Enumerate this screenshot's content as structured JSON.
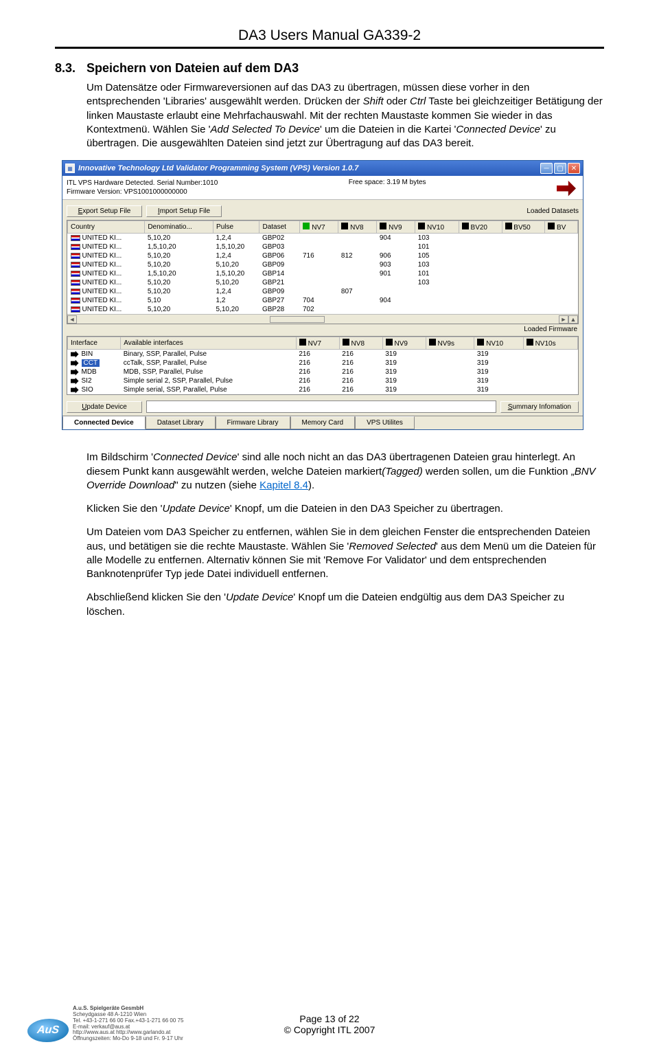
{
  "doc": {
    "header": "DA3 Users Manual GA339-2",
    "section_number": "8.3.",
    "section_title": "Speichern von Dateien auf dem DA3",
    "p1a": "Um Datensätze oder Firmwareversionen auf das DA3 zu übertragen, müssen diese vorher in den entsprechenden 'Libraries' ausgewählt werden. Drücken der ",
    "p1_shift": "Shift",
    "p1b": " oder ",
    "p1_ctrl": "Ctrl",
    "p1c": " Taste bei gleichzeitiger Betätigung der linken Maustaste erlaubt eine Mehrfachauswahl. Mit der rechten Maustaste kommen Sie wieder in das Kontextmenü. Wählen Sie '",
    "p1_add": "Add Selected To Device",
    "p1d": "' um die Dateien in die Kartei '",
    "p1_conn": "Connected Device",
    "p1e": "' zu übertragen. Die ausgewählten Dateien sind jetzt zur Übertragung auf das DA3 bereit.",
    "p2a": "Im Bildschirm '",
    "p2_conn": "Connected Device",
    "p2b": "' sind alle noch nicht an das DA3 übertragenen Dateien grau hinterlegt. An diesem Punkt kann ausgewählt werden, welche Dateien markiert",
    "p2_tagged": "(Tagged)",
    "p2c": " werden sollen, um die Funktion „",
    "p2_bnv": "BNV Override Download",
    "p2d": "\" zu nutzen (siehe ",
    "p2_link": "Kapitel 8.4",
    "p2e": ").",
    "p3a": "Klicken Sie den '",
    "p3_upd": "Update Device",
    "p3b": "'  Knopf, um die Dateien in den DA3 Speicher zu übertragen.",
    "p4a": "Um Dateien vom DA3 Speicher zu entfernen, wählen Sie in dem gleichen Fenster die entsprechenden Dateien aus, und betätigen sie die rechte Maustaste. Wählen Sie '",
    "p4_rem": "Removed Selected",
    "p4b": "' aus dem Menü um die Dateien für alle Modelle zu entfernen. Alternativ können Sie mit 'Remove For Validator' und dem entsprechenden Banknotenprüfer Typ jede Datei individuell entfernen.",
    "p5a": "Abschließend klicken Sie den '",
    "p5_upd": "Update Device",
    "p5b": "' Knopf um die Dateien endgültig aus dem DA3 Speicher zu löschen.",
    "page_num": "Page 13 of 22",
    "copyright": "© Copyright ITL 2007"
  },
  "app": {
    "title": "Innovative Technology Ltd Validator Programming System (VPS)    Version 1.0.7",
    "info_line1": "ITL VPS Hardware Detected. Serial Number:1010",
    "info_line2": "Firmware Version: VPS1001000000000",
    "free_space": "Free space: 3.19 M bytes",
    "btn_export": "Export Setup File",
    "btn_import": "Import Setup File",
    "label_loaded_ds": "Loaded Datasets",
    "label_loaded_fw": "Loaded Firmware",
    "btn_update": "Update Device",
    "btn_summary": "Summary Infomation",
    "tabs": {
      "connected": "Connected Device",
      "dataset": "Dataset Library",
      "firmware": "Firmware Library",
      "memory": "Memory Card",
      "vps": "VPS Utilites"
    },
    "grid1": {
      "headers": [
        "Country",
        "Denominatio...",
        "Pulse",
        "Dataset",
        "NV7",
        "NV8",
        "NV9",
        "NV10",
        "BV20",
        "BV50",
        "BV"
      ],
      "rows": [
        [
          "UNITED KI...",
          "5,10,20",
          "1,2,4",
          "GBP02",
          "",
          "",
          "904",
          "103",
          "",
          "",
          ""
        ],
        [
          "UNITED KI...",
          "1,5,10,20",
          "1,5,10,20",
          "GBP03",
          "",
          "",
          "",
          "101",
          "",
          "",
          ""
        ],
        [
          "UNITED KI...",
          "5,10,20",
          "1,2,4",
          "GBP06",
          "716",
          "812",
          "906",
          "105",
          "",
          "",
          ""
        ],
        [
          "UNITED KI...",
          "5,10,20",
          "5,10,20",
          "GBP09",
          "",
          "",
          "903",
          "103",
          "",
          "",
          ""
        ],
        [
          "UNITED KI...",
          "1,5,10,20",
          "1,5,10,20",
          "GBP14",
          "",
          "",
          "901",
          "101",
          "",
          "",
          ""
        ],
        [
          "UNITED KI...",
          "5,10,20",
          "5,10,20",
          "GBP21",
          "",
          "",
          "",
          "103",
          "",
          "",
          ""
        ],
        [
          "UNITED KI...",
          "5,10,20",
          "1,2,4",
          "GBP09",
          "",
          "807",
          "",
          "",
          "",
          "",
          ""
        ],
        [
          "UNITED KI...",
          "5,10",
          "1,2",
          "GBP27",
          "704",
          "",
          "904",
          "",
          "",
          "",
          ""
        ],
        [
          "UNITED KI...",
          "5,10,20",
          "5,10,20",
          "GBP28",
          "702",
          "",
          "",
          "",
          "",
          "",
          ""
        ]
      ]
    },
    "grid2": {
      "headers": [
        "Interface",
        "Available interfaces",
        "NV7",
        "NV8",
        "NV9",
        "NV9s",
        "NV10",
        "NV10s"
      ],
      "rows": [
        {
          "sel": false,
          "iface": "BIN",
          "desc": "Binary, SSP, Parallel, Pulse",
          "v": [
            "216",
            "216",
            "319",
            "",
            "319",
            ""
          ]
        },
        {
          "sel": true,
          "iface": "CCT",
          "desc": "ccTalk, SSP, Parallel, Pulse",
          "v": [
            "216",
            "216",
            "319",
            "",
            "319",
            ""
          ]
        },
        {
          "sel": false,
          "iface": "MDB",
          "desc": "MDB, SSP, Parallel, Pulse",
          "v": [
            "216",
            "216",
            "319",
            "",
            "319",
            ""
          ]
        },
        {
          "sel": false,
          "iface": "SI2",
          "desc": "Simple serial 2, SSP, Parallel, Pulse",
          "v": [
            "216",
            "216",
            "319",
            "",
            "319",
            ""
          ]
        },
        {
          "sel": false,
          "iface": "SIO",
          "desc": "Simple serial, SSP, Parallel, Pulse",
          "v": [
            "216",
            "216",
            "319",
            "",
            "319",
            ""
          ]
        }
      ]
    }
  },
  "footer_org": {
    "name": "A.u.S. Spielgeräte GesmbH",
    "addr": "Scheydgasse 48   A-1210 Wien",
    "tel": "Tel. +43-1-271 66 00  Fax.+43-1-271 66 00 75",
    "email": "E-mail: verkauf@aus.at",
    "web": "http://www.aus.at   http://www.garlando.at",
    "hours": "Öffnungszeiten: Mo-Do 9-18 und Fr. 9-17 Uhr"
  }
}
